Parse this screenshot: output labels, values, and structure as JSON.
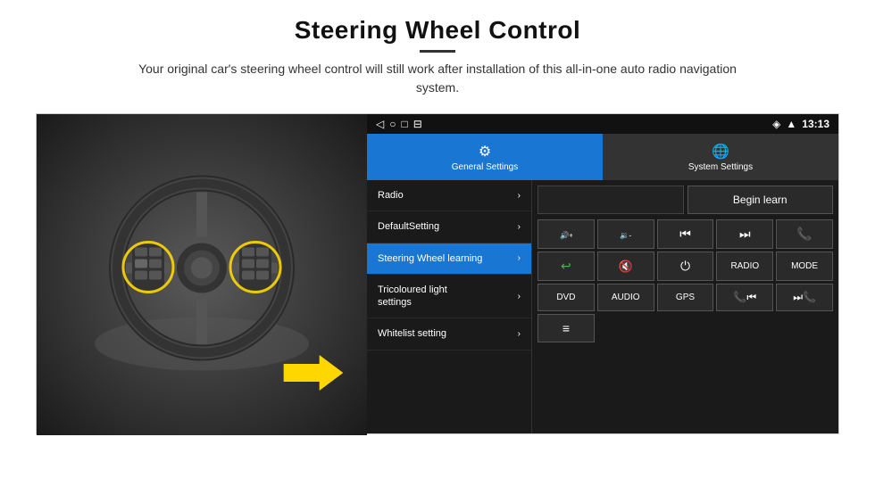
{
  "header": {
    "title": "Steering Wheel Control",
    "divider": true,
    "subtitle": "Your original car's steering wheel control will still work after installation of this all-in-one auto radio navigation system."
  },
  "tabs": [
    {
      "id": "general",
      "label": "General Settings",
      "active": true,
      "icon": "⚙"
    },
    {
      "id": "system",
      "label": "System Settings",
      "active": false,
      "icon": "🌐"
    }
  ],
  "status_bar": {
    "time": "13:13",
    "nav_icons": [
      "◁",
      "○",
      "□",
      "⊟"
    ]
  },
  "menu_items": [
    {
      "label": "Radio",
      "active": false
    },
    {
      "label": "DefaultSetting",
      "active": false
    },
    {
      "label": "Steering Wheel learning",
      "active": true
    },
    {
      "label": "Tricoloured light settings",
      "active": false
    },
    {
      "label": "Whitelist setting",
      "active": false
    }
  ],
  "controls": {
    "begin_learn_label": "Begin learn",
    "row1": [
      {
        "label": "🔊+",
        "type": "vol-up"
      },
      {
        "label": "🔊-",
        "type": "vol-down"
      },
      {
        "label": "⏮",
        "type": "prev"
      },
      {
        "label": "⏭",
        "type": "next"
      },
      {
        "label": "📞",
        "type": "phone"
      }
    ],
    "row2": [
      {
        "label": "📞",
        "type": "answer"
      },
      {
        "label": "🔇",
        "type": "mute"
      },
      {
        "label": "⏻",
        "type": "power"
      },
      {
        "label": "RADIO",
        "type": "radio"
      },
      {
        "label": "MODE",
        "type": "mode"
      }
    ],
    "row3": [
      {
        "label": "DVD",
        "type": "dvd"
      },
      {
        "label": "AUDIO",
        "type": "audio"
      },
      {
        "label": "GPS",
        "type": "gps"
      },
      {
        "label": "📞⏮",
        "type": "phone-prev"
      },
      {
        "label": "⏭📞",
        "type": "phone-next"
      }
    ],
    "row4": [
      {
        "label": "📋",
        "type": "list"
      }
    ]
  }
}
